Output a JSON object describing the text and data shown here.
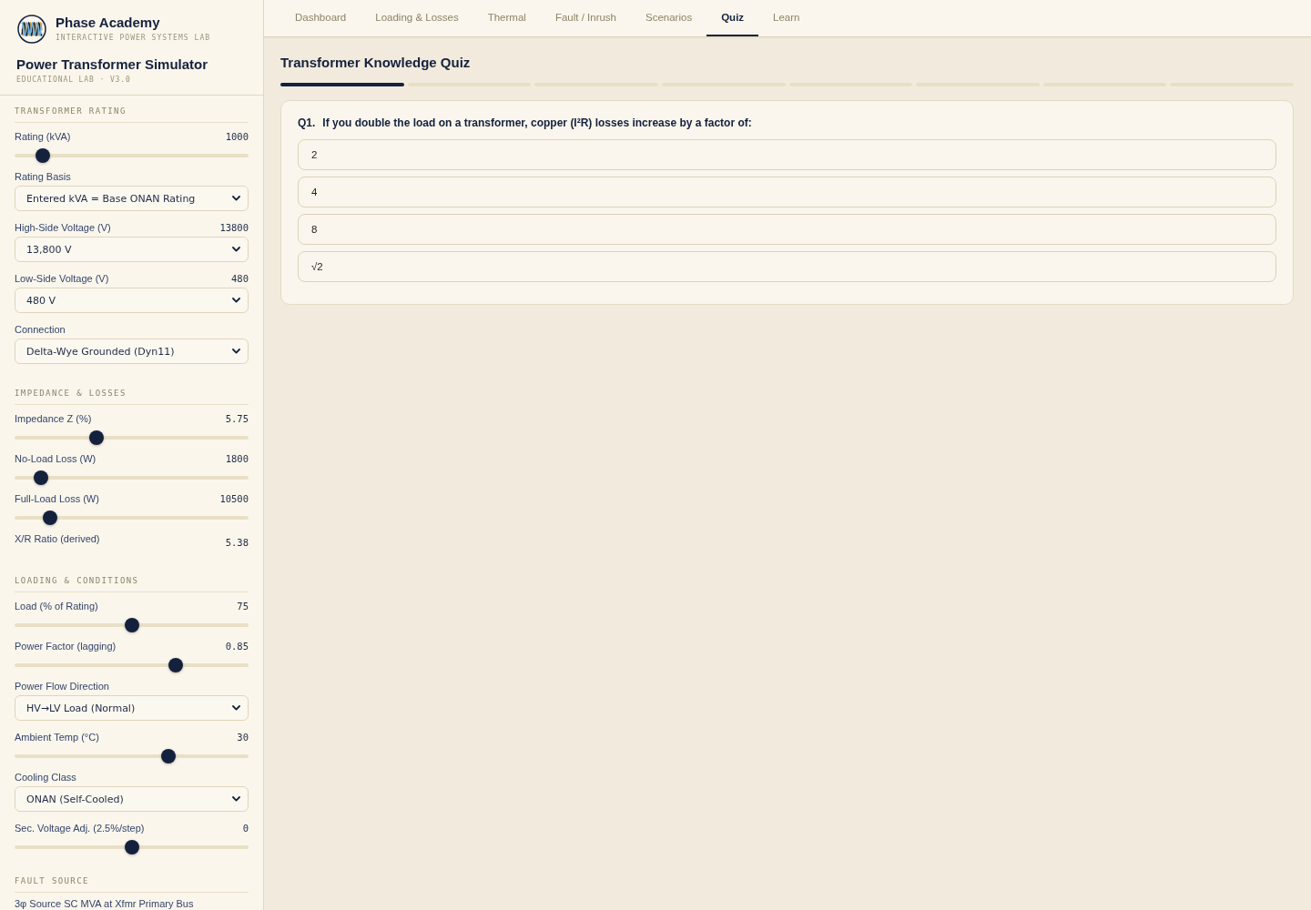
{
  "brand": {
    "name": "Phase Academy",
    "tagline": "INTERACTIVE POWER SYSTEMS LAB"
  },
  "app": {
    "title": "Power Transformer Simulator",
    "subtitle": "EDUCATIONAL LAB · V3.0"
  },
  "sidebar": {
    "sections": [
      {
        "title": "TRANSFORMER RATING",
        "controls": [
          {
            "kind": "slider",
            "label": "Rating (kVA)",
            "reading": "1000",
            "level": 0.095
          },
          {
            "kind": "select",
            "label": "Rating Basis",
            "value": "Entered kVA = Base ONAN Rating"
          },
          {
            "kind": "select",
            "label": "High-Side Voltage (V)",
            "reading": "13800",
            "value": "13,800 V"
          },
          {
            "kind": "select",
            "label": "Low-Side Voltage (V)",
            "reading": "480",
            "value": "480 V"
          },
          {
            "kind": "select",
            "label": "Connection",
            "value": "Delta-Wye Grounded (Dyn11)"
          }
        ]
      },
      {
        "title": "IMPEDANCE & LOSSES",
        "controls": [
          {
            "kind": "slider",
            "label": "Impedance Z (%)",
            "reading": "5.75",
            "level": 0.34
          },
          {
            "kind": "slider",
            "label": "No-Load Loss (W)",
            "reading": "1800",
            "level": 0.087
          },
          {
            "kind": "slider",
            "label": "Full-Load Loss (W)",
            "reading": "10500",
            "level": 0.129
          },
          {
            "kind": "readout",
            "label": "X/R Ratio (derived)",
            "reading": "5.38"
          }
        ]
      },
      {
        "title": "LOADING & CONDITIONS",
        "controls": [
          {
            "kind": "slider",
            "label": "Load (% of Rating)",
            "reading": "75",
            "level": 0.5
          },
          {
            "kind": "slider",
            "label": "Power Factor (lagging)",
            "reading": "0.85",
            "level": 0.7
          },
          {
            "kind": "select",
            "label": "Power Flow Direction",
            "value": "HV→LV Load (Normal)"
          },
          {
            "kind": "slider",
            "label": "Ambient Temp (°C)",
            "reading": "30",
            "level": 0.668
          },
          {
            "kind": "select",
            "label": "Cooling Class",
            "value": "ONAN (Self-Cooled)"
          },
          {
            "kind": "slider",
            "label": "Sec. Voltage Adj. (2.5%/step)",
            "reading": "0",
            "level": 0.5
          }
        ]
      },
      {
        "title": "FAULT SOURCE",
        "controls": [
          {
            "kind": "caption",
            "label": "3φ Source SC MVA at Xfmr Primary Bus"
          }
        ]
      }
    ]
  },
  "tabs": [
    {
      "label": "Dashboard",
      "selected": false
    },
    {
      "label": "Loading & Losses",
      "selected": false
    },
    {
      "label": "Thermal",
      "selected": false
    },
    {
      "label": "Fault / Inrush",
      "selected": false
    },
    {
      "label": "Scenarios",
      "selected": false
    },
    {
      "label": "Quiz",
      "selected": true
    },
    {
      "label": "Learn",
      "selected": false
    }
  ],
  "quiz": {
    "title": "Transformer Knowledge Quiz",
    "progress": [
      {
        "active": true
      },
      {
        "active": false
      },
      {
        "active": false
      },
      {
        "active": false
      },
      {
        "active": false
      },
      {
        "active": false
      },
      {
        "active": false
      },
      {
        "active": false
      }
    ],
    "question": {
      "number": "Q1.",
      "text": "If you double the load on a transformer, copper (I²R) losses increase by a factor of:"
    },
    "options": [
      {
        "label": "2",
        "selected": false
      },
      {
        "label": "4",
        "selected": false
      },
      {
        "label": "8",
        "selected": false
      },
      {
        "label": "√2",
        "selected": false
      }
    ]
  }
}
